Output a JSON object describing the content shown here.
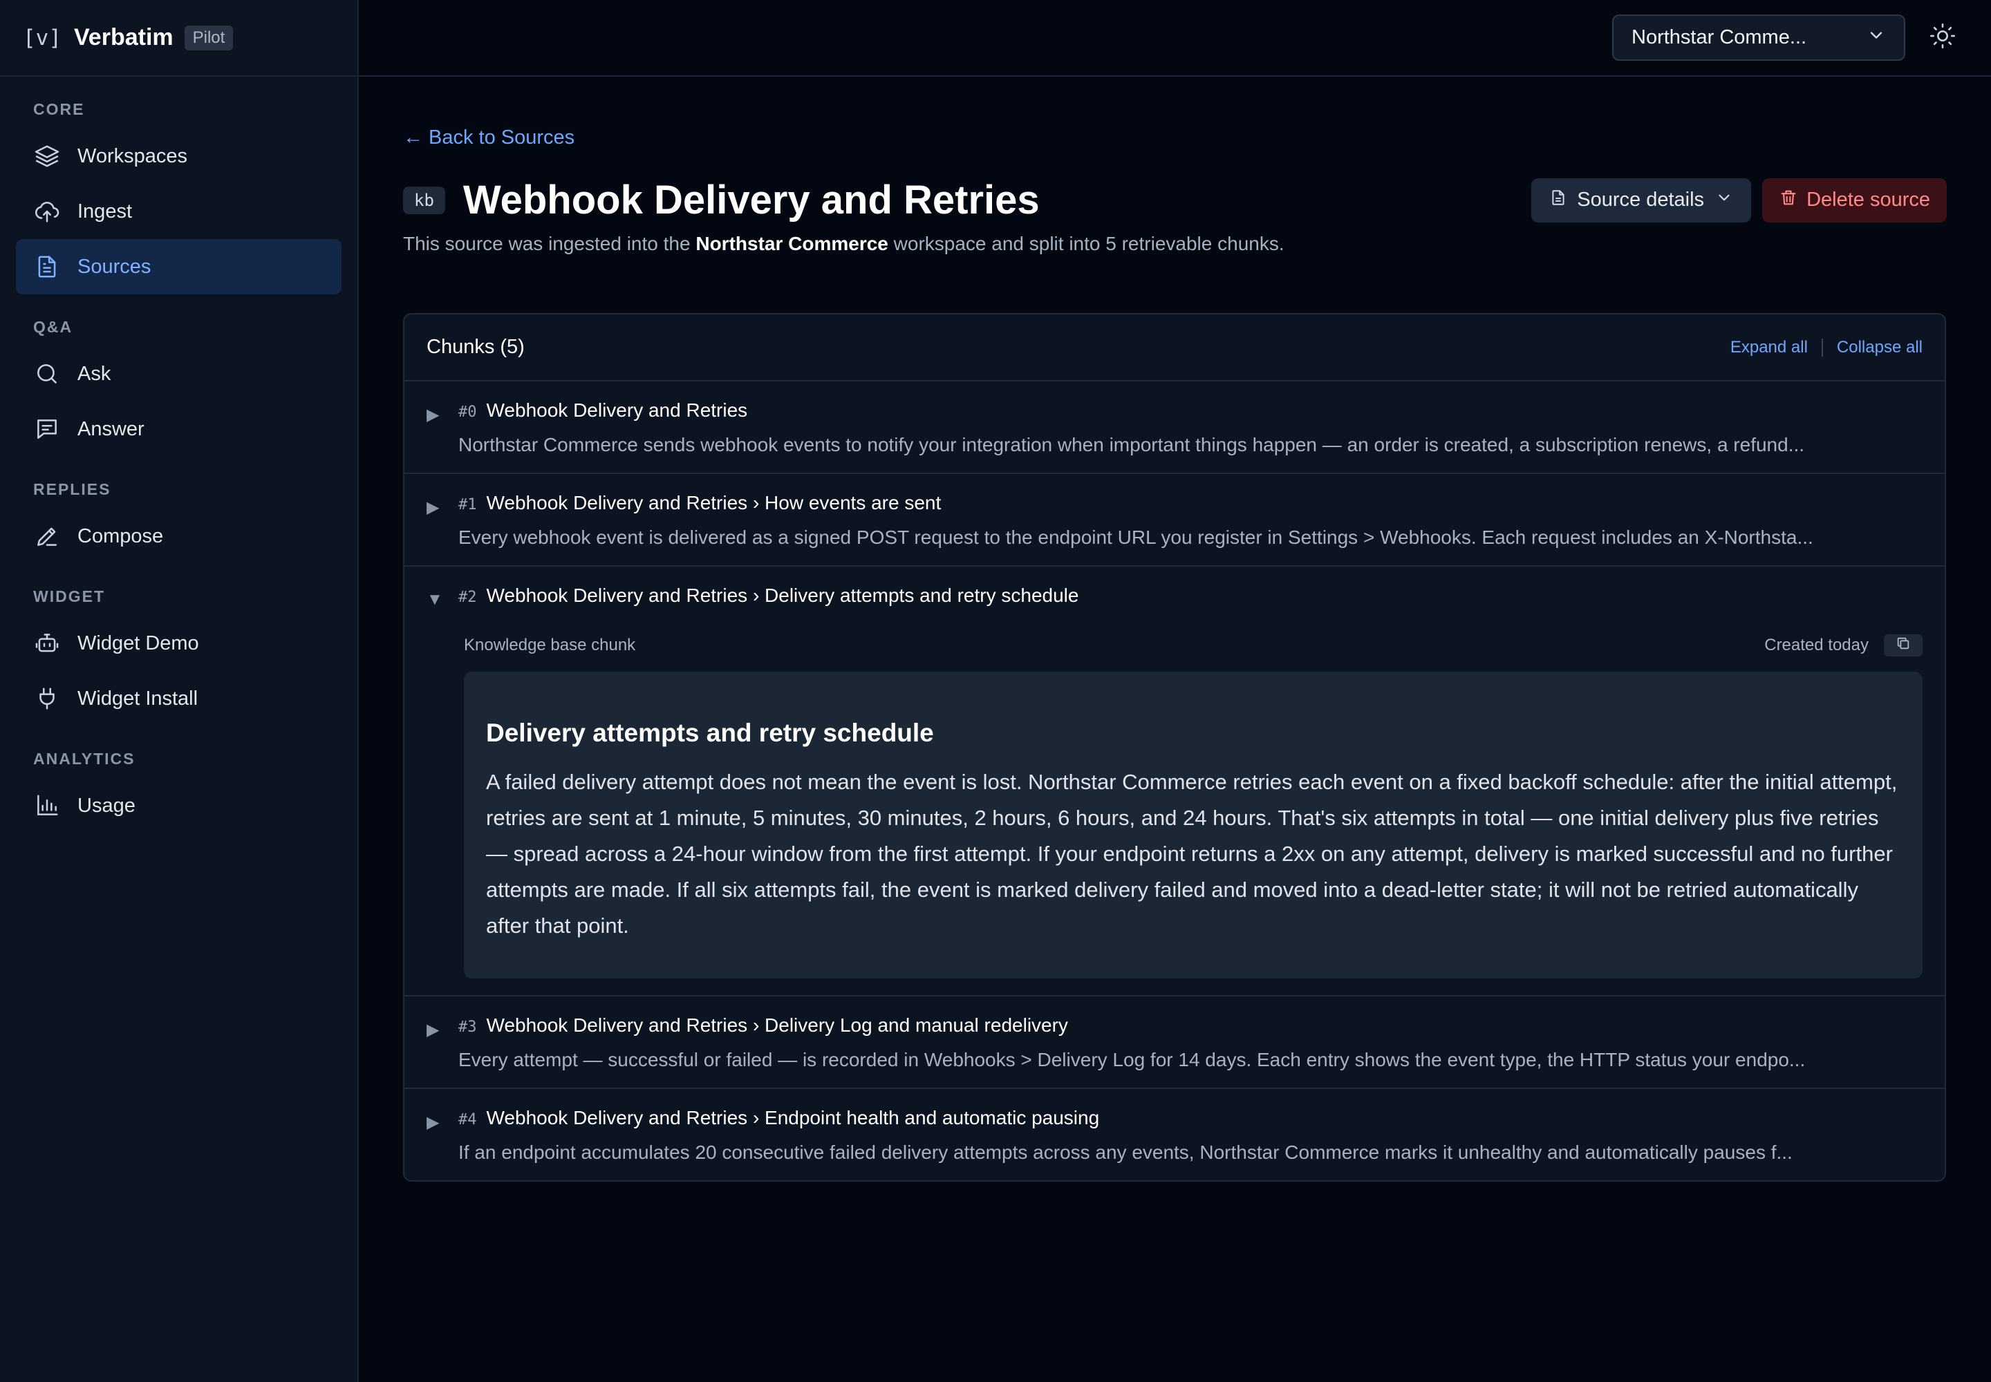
{
  "brand": {
    "mark": "[v]",
    "name": "Verbatim",
    "badge": "Pilot"
  },
  "nav": {
    "sections": [
      {
        "heading": "CORE",
        "items": [
          {
            "label": "Workspaces",
            "icon": "layers-icon"
          },
          {
            "label": "Ingest",
            "icon": "cloud-upload-icon"
          },
          {
            "label": "Sources",
            "icon": "document-icon",
            "active": true
          }
        ]
      },
      {
        "heading": "Q&A",
        "items": [
          {
            "label": "Ask",
            "icon": "search-icon"
          },
          {
            "label": "Answer",
            "icon": "message-icon"
          }
        ]
      },
      {
        "heading": "REPLIES",
        "items": [
          {
            "label": "Compose",
            "icon": "pen-icon"
          }
        ]
      },
      {
        "heading": "WIDGET",
        "items": [
          {
            "label": "Widget Demo",
            "icon": "bot-icon"
          },
          {
            "label": "Widget Install",
            "icon": "plug-icon"
          }
        ]
      },
      {
        "heading": "ANALYTICS",
        "items": [
          {
            "label": "Usage",
            "icon": "bar-chart-icon"
          }
        ]
      }
    ]
  },
  "topbar": {
    "workspace": "Northstar Comme...",
    "theme_icon": "sun-icon"
  },
  "page": {
    "back_label": "Back to Sources",
    "badge": "kb",
    "title": "Webhook Delivery and Retries",
    "details_label": "Source details",
    "delete_label": "Delete source",
    "subtitle_pre": "This source was ingested into the ",
    "subtitle_workspace": "Northstar Commerce",
    "subtitle_post": " workspace and split into 5 retrievable chunks."
  },
  "chunks": {
    "header": "Chunks (5)",
    "expand_all": "Expand all",
    "collapse_all": "Collapse all",
    "items": [
      {
        "index": "#0",
        "title": "Webhook Delivery and Retries",
        "preview": "Northstar Commerce sends webhook events to notify your integration when important things happen — an order is created, a subscription renews, a refund..."
      },
      {
        "index": "#1",
        "title": "Webhook Delivery and Retries › How events are sent",
        "preview": "Every webhook event is delivered as a signed POST request to the endpoint URL you register in Settings > Webhooks. Each request includes an X-Northsta..."
      },
      {
        "index": "#2",
        "title": "Webhook Delivery and Retries › Delivery attempts and retry schedule",
        "expanded": true,
        "meta_label": "Knowledge base chunk",
        "created": "Created today",
        "heading": "Delivery attempts and retry schedule",
        "body": "A failed delivery attempt does not mean the event is lost. Northstar Commerce retries each event on a fixed backoff schedule: after the initial attempt, retries are sent at 1 minute, 5 minutes, 30 minutes, 2 hours, 6 hours, and 24 hours. That's six attempts in total — one initial delivery plus five retries — spread across a 24-hour window from the first attempt. If your endpoint returns a 2xx on any attempt, delivery is marked successful and no further attempts are made. If all six attempts fail, the event is marked delivery failed and moved into a dead-letter state; it will not be retried automatically after that point."
      },
      {
        "index": "#3",
        "title": "Webhook Delivery and Retries › Delivery Log and manual redelivery",
        "preview": "Every attempt — successful or failed — is recorded in Webhooks > Delivery Log for 14 days. Each entry shows the event type, the HTTP status your endpo..."
      },
      {
        "index": "#4",
        "title": "Webhook Delivery and Retries › Endpoint health and automatic pausing",
        "preview": "If an endpoint accumulates 20 consecutive failed delivery attempts across any events, Northstar Commerce marks it unhealthy and automatically pauses f..."
      }
    ]
  },
  "colors": {
    "accent": "#6ea8fe",
    "danger": "#ff8a8a",
    "background": "#020712",
    "sidebar": "#0c1422"
  }
}
